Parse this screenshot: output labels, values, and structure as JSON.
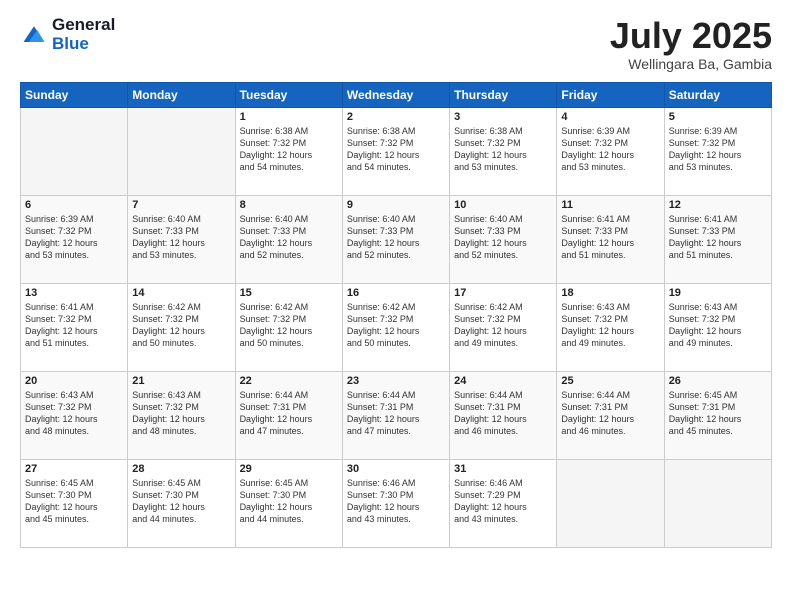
{
  "logo": {
    "general": "General",
    "blue": "Blue"
  },
  "title": {
    "month_year": "July 2025",
    "location": "Wellingara Ba, Gambia"
  },
  "weekdays": [
    "Sunday",
    "Monday",
    "Tuesday",
    "Wednesday",
    "Thursday",
    "Friday",
    "Saturday"
  ],
  "weeks": [
    [
      {
        "day": "",
        "info": ""
      },
      {
        "day": "",
        "info": ""
      },
      {
        "day": "1",
        "info": "Sunrise: 6:38 AM\nSunset: 7:32 PM\nDaylight: 12 hours\nand 54 minutes."
      },
      {
        "day": "2",
        "info": "Sunrise: 6:38 AM\nSunset: 7:32 PM\nDaylight: 12 hours\nand 54 minutes."
      },
      {
        "day": "3",
        "info": "Sunrise: 6:38 AM\nSunset: 7:32 PM\nDaylight: 12 hours\nand 53 minutes."
      },
      {
        "day": "4",
        "info": "Sunrise: 6:39 AM\nSunset: 7:32 PM\nDaylight: 12 hours\nand 53 minutes."
      },
      {
        "day": "5",
        "info": "Sunrise: 6:39 AM\nSunset: 7:32 PM\nDaylight: 12 hours\nand 53 minutes."
      }
    ],
    [
      {
        "day": "6",
        "info": "Sunrise: 6:39 AM\nSunset: 7:32 PM\nDaylight: 12 hours\nand 53 minutes."
      },
      {
        "day": "7",
        "info": "Sunrise: 6:40 AM\nSunset: 7:33 PM\nDaylight: 12 hours\nand 53 minutes."
      },
      {
        "day": "8",
        "info": "Sunrise: 6:40 AM\nSunset: 7:33 PM\nDaylight: 12 hours\nand 52 minutes."
      },
      {
        "day": "9",
        "info": "Sunrise: 6:40 AM\nSunset: 7:33 PM\nDaylight: 12 hours\nand 52 minutes."
      },
      {
        "day": "10",
        "info": "Sunrise: 6:40 AM\nSunset: 7:33 PM\nDaylight: 12 hours\nand 52 minutes."
      },
      {
        "day": "11",
        "info": "Sunrise: 6:41 AM\nSunset: 7:33 PM\nDaylight: 12 hours\nand 51 minutes."
      },
      {
        "day": "12",
        "info": "Sunrise: 6:41 AM\nSunset: 7:33 PM\nDaylight: 12 hours\nand 51 minutes."
      }
    ],
    [
      {
        "day": "13",
        "info": "Sunrise: 6:41 AM\nSunset: 7:32 PM\nDaylight: 12 hours\nand 51 minutes."
      },
      {
        "day": "14",
        "info": "Sunrise: 6:42 AM\nSunset: 7:32 PM\nDaylight: 12 hours\nand 50 minutes."
      },
      {
        "day": "15",
        "info": "Sunrise: 6:42 AM\nSunset: 7:32 PM\nDaylight: 12 hours\nand 50 minutes."
      },
      {
        "day": "16",
        "info": "Sunrise: 6:42 AM\nSunset: 7:32 PM\nDaylight: 12 hours\nand 50 minutes."
      },
      {
        "day": "17",
        "info": "Sunrise: 6:42 AM\nSunset: 7:32 PM\nDaylight: 12 hours\nand 49 minutes."
      },
      {
        "day": "18",
        "info": "Sunrise: 6:43 AM\nSunset: 7:32 PM\nDaylight: 12 hours\nand 49 minutes."
      },
      {
        "day": "19",
        "info": "Sunrise: 6:43 AM\nSunset: 7:32 PM\nDaylight: 12 hours\nand 49 minutes."
      }
    ],
    [
      {
        "day": "20",
        "info": "Sunrise: 6:43 AM\nSunset: 7:32 PM\nDaylight: 12 hours\nand 48 minutes."
      },
      {
        "day": "21",
        "info": "Sunrise: 6:43 AM\nSunset: 7:32 PM\nDaylight: 12 hours\nand 48 minutes."
      },
      {
        "day": "22",
        "info": "Sunrise: 6:44 AM\nSunset: 7:31 PM\nDaylight: 12 hours\nand 47 minutes."
      },
      {
        "day": "23",
        "info": "Sunrise: 6:44 AM\nSunset: 7:31 PM\nDaylight: 12 hours\nand 47 minutes."
      },
      {
        "day": "24",
        "info": "Sunrise: 6:44 AM\nSunset: 7:31 PM\nDaylight: 12 hours\nand 46 minutes."
      },
      {
        "day": "25",
        "info": "Sunrise: 6:44 AM\nSunset: 7:31 PM\nDaylight: 12 hours\nand 46 minutes."
      },
      {
        "day": "26",
        "info": "Sunrise: 6:45 AM\nSunset: 7:31 PM\nDaylight: 12 hours\nand 45 minutes."
      }
    ],
    [
      {
        "day": "27",
        "info": "Sunrise: 6:45 AM\nSunset: 7:30 PM\nDaylight: 12 hours\nand 45 minutes."
      },
      {
        "day": "28",
        "info": "Sunrise: 6:45 AM\nSunset: 7:30 PM\nDaylight: 12 hours\nand 44 minutes."
      },
      {
        "day": "29",
        "info": "Sunrise: 6:45 AM\nSunset: 7:30 PM\nDaylight: 12 hours\nand 44 minutes."
      },
      {
        "day": "30",
        "info": "Sunrise: 6:46 AM\nSunset: 7:30 PM\nDaylight: 12 hours\nand 43 minutes."
      },
      {
        "day": "31",
        "info": "Sunrise: 6:46 AM\nSunset: 7:29 PM\nDaylight: 12 hours\nand 43 minutes."
      },
      {
        "day": "",
        "info": ""
      },
      {
        "day": "",
        "info": ""
      }
    ]
  ]
}
